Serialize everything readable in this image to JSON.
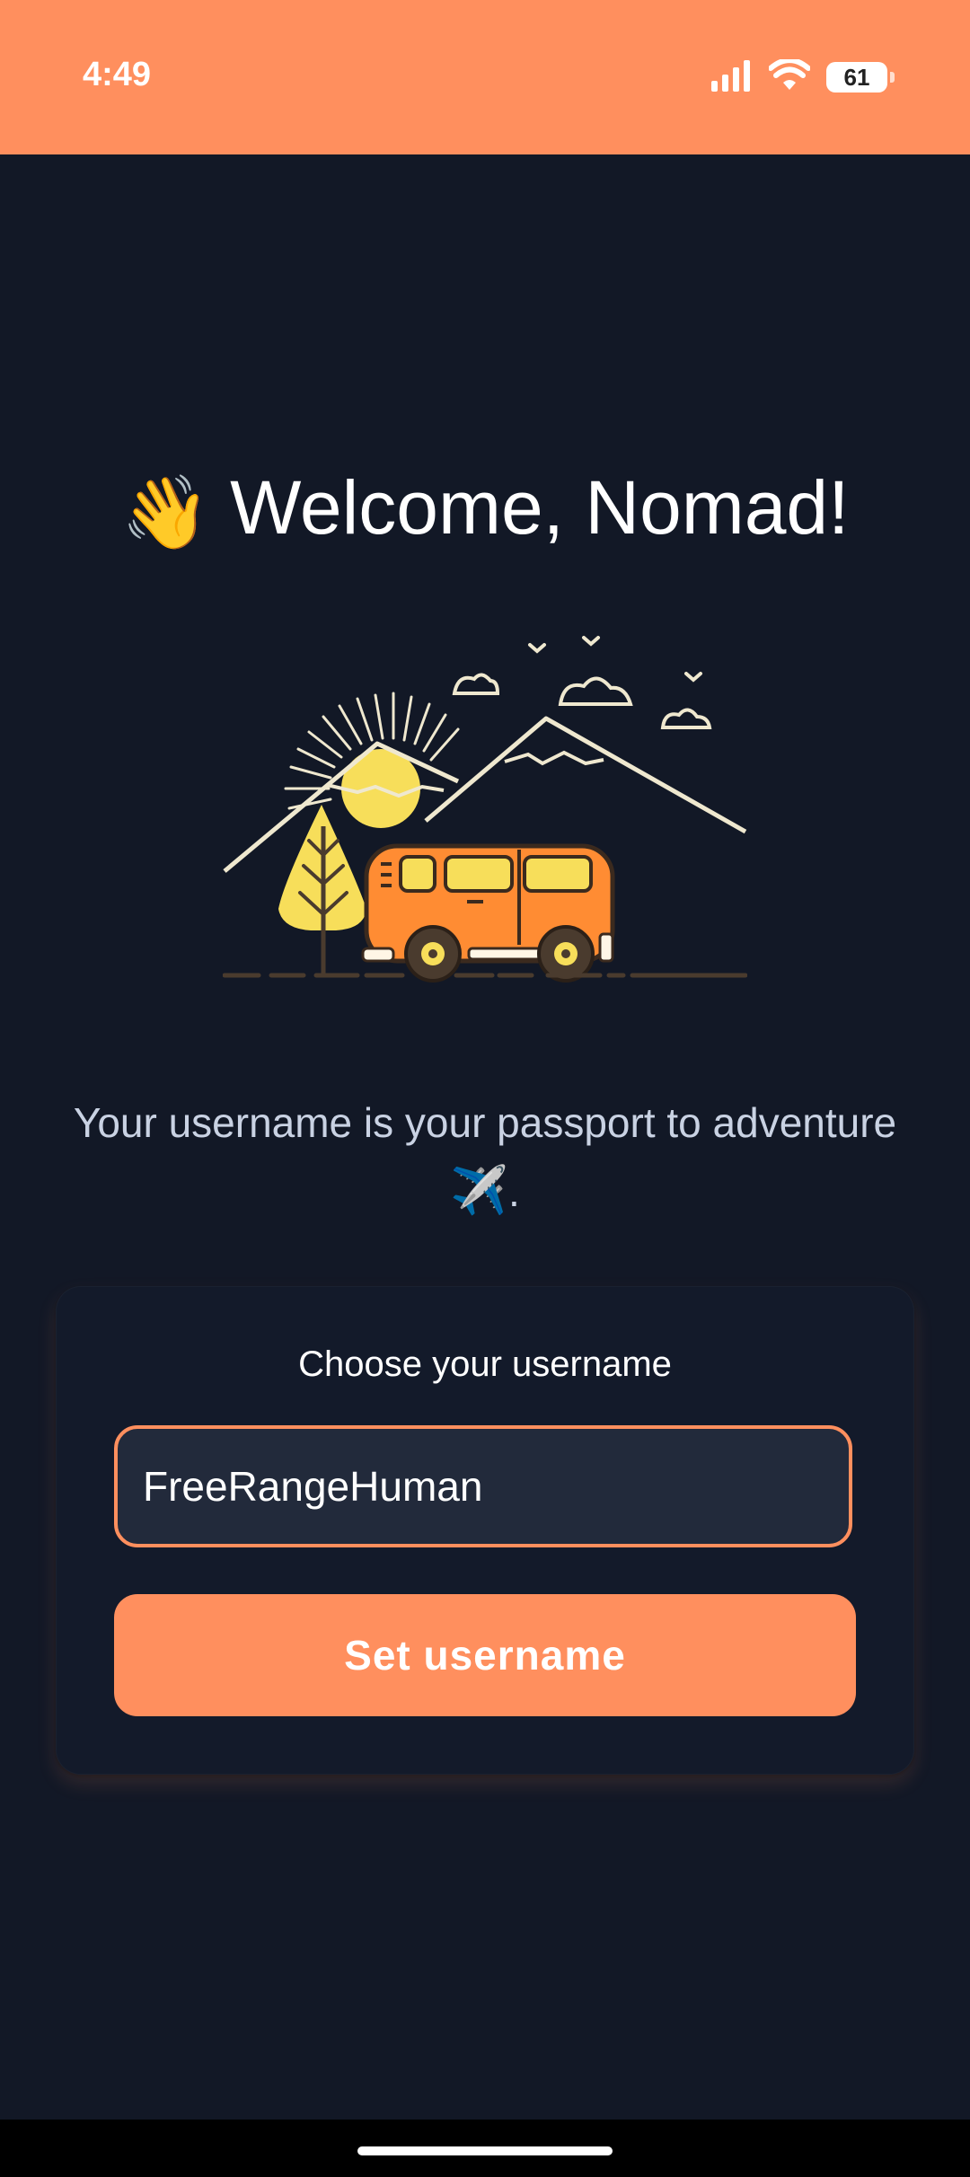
{
  "status_bar": {
    "time": "4:49",
    "battery_level": "61",
    "icons": [
      "signal-icon",
      "wifi-icon",
      "battery-icon"
    ]
  },
  "welcome": {
    "emoji": "👋",
    "title": "Welcome, Nomad!"
  },
  "illustration": {
    "name": "van-mountains-illustration"
  },
  "subtitle": {
    "text": "Your username is your passport to adventure",
    "emoji": "✈️",
    "suffix": "."
  },
  "form": {
    "label": "Choose your username",
    "username_value": "FreeRangeHuman",
    "submit_label": "Set username"
  },
  "colors": {
    "accent": "#FF8F5E",
    "background": "#121826",
    "input_background": "#222A3B",
    "subtitle": "#C9D2E3"
  }
}
